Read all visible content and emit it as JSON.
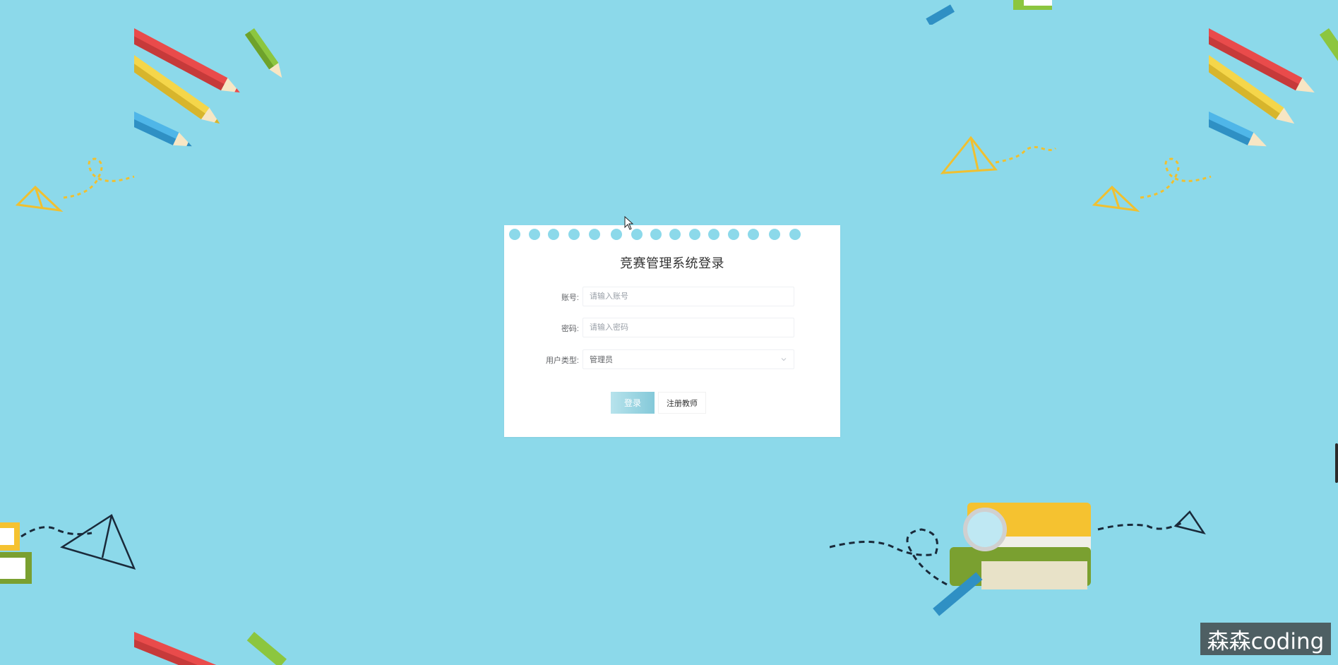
{
  "login": {
    "title": "竞赛管理系统登录",
    "account_label": "账号:",
    "account_placeholder": "请输入账号",
    "password_label": "密码:",
    "password_placeholder": "请输入密码",
    "usertype_label": "用户类型:",
    "usertype_value": "管理员",
    "login_button": "登录",
    "register_button": "注册教师"
  },
  "watermark": "森森coding",
  "colors": {
    "background": "#8cd9ea",
    "card": "#ffffff",
    "accent": "#84c9d9"
  }
}
